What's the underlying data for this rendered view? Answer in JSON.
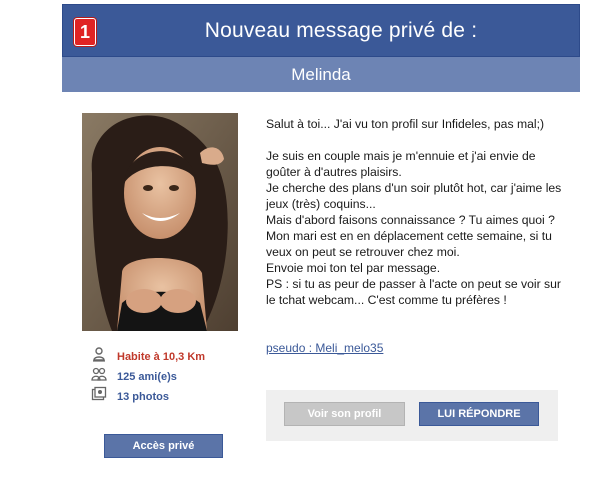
{
  "header": {
    "badge_count": "1",
    "title": "Nouveau message privé de :",
    "sender_name": "Melinda"
  },
  "profile": {
    "photo_icon": "profile-photo",
    "stats": [
      {
        "icon": "person-pin-icon",
        "text": "Habite à 10,3 Km",
        "color": "#c0392b"
      },
      {
        "icon": "friends-icon",
        "text": "125 ami(e)s",
        "color": "#3b5998"
      },
      {
        "icon": "photos-icon",
        "text": "13 photos",
        "color": "#3b5998"
      }
    ],
    "private_access_label": "Accès privé"
  },
  "message": {
    "lines": [
      "Salut à toi... J'ai vu ton profil sur Infideles, pas mal;)",
      "",
      "Je suis en couple mais je m'ennuie et j'ai envie de goûter à d'autres plaisirs.",
      "Je cherche des plans d'un soir plutôt hot, car j'aime les jeux (très) coquins...",
      "Mais d'abord faisons connaissance ? Tu aimes quoi ?",
      "Mon mari est en en déplacement cette semaine, si tu veux on peut se retrouver chez moi.",
      "Envoie moi ton tel par message.",
      "PS : si tu as peur de passer à l'acte on peut se voir sur le tchat webcam... C'est comme tu préfères !"
    ],
    "pseudo_link": "pseudo : Meli_melo35"
  },
  "actions": {
    "view_profile_label": "Voir son profil",
    "reply_label": "LUI RÉPONDRE"
  },
  "colors": {
    "header_bg": "#3b5998",
    "subheader_bg": "#6d84b4",
    "badge_bg": "#e02424",
    "button_blue": "#5b74a8",
    "button_grey": "#c7c7c7",
    "distance_red": "#c0392b"
  }
}
